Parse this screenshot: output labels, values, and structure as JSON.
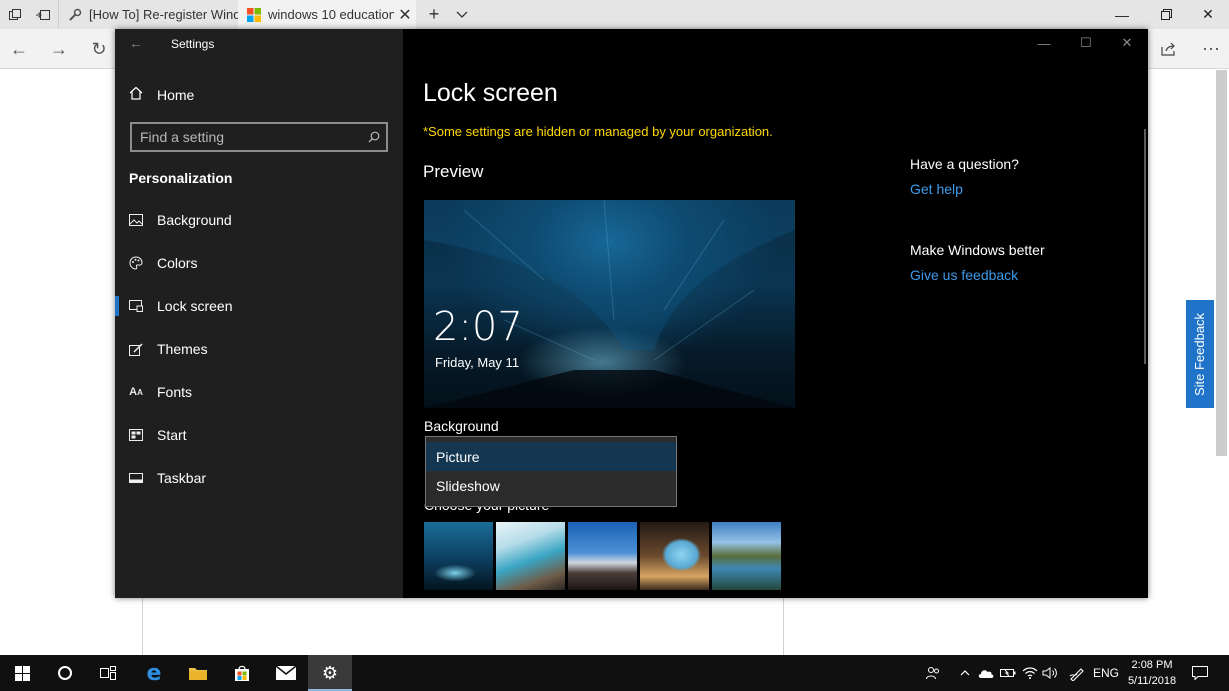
{
  "browser": {
    "tabs": [
      {
        "label": "[How To] Re-register Windo",
        "active": false
      },
      {
        "label": "windows 10 education",
        "active": true
      }
    ],
    "new_tab_icon": "plus-icon",
    "tab_list_icon": "chevron-down-icon"
  },
  "settings": {
    "window_title": "Settings",
    "home_label": "Home",
    "search_placeholder": "Find a setting",
    "section_title": "Personalization",
    "nav_items": [
      {
        "label": "Background",
        "icon": "picture-icon"
      },
      {
        "label": "Colors",
        "icon": "palette-icon"
      },
      {
        "label": "Lock screen",
        "icon": "lock-screen-icon",
        "selected": true
      },
      {
        "label": "Themes",
        "icon": "brush-icon"
      },
      {
        "label": "Fonts",
        "icon": "font-icon"
      },
      {
        "label": "Start",
        "icon": "start-icon"
      },
      {
        "label": "Taskbar",
        "icon": "taskbar-icon"
      }
    ],
    "page_title": "Lock screen",
    "notice": "*Some settings are hidden or managed by your organization.",
    "preview_heading": "Preview",
    "preview_time": "2:07",
    "preview_date": "Friday, May 11",
    "background_label": "Background",
    "background_options": [
      "Picture",
      "Slideshow"
    ],
    "background_selected": "Picture",
    "choose_picture_label": "Choose your picture",
    "help_heading": "Have a question?",
    "help_link": "Get help",
    "feedback_heading": "Make Windows better",
    "feedback_link": "Give us feedback"
  },
  "page": {
    "site_feedback": "Site Feedback"
  },
  "taskbar": {
    "language": "ENG",
    "time": "2:08 PM",
    "date": "5/11/2018"
  },
  "colors": {
    "accent": "#1f74c9",
    "notice": "#ffd800",
    "link": "#3d9be9"
  }
}
